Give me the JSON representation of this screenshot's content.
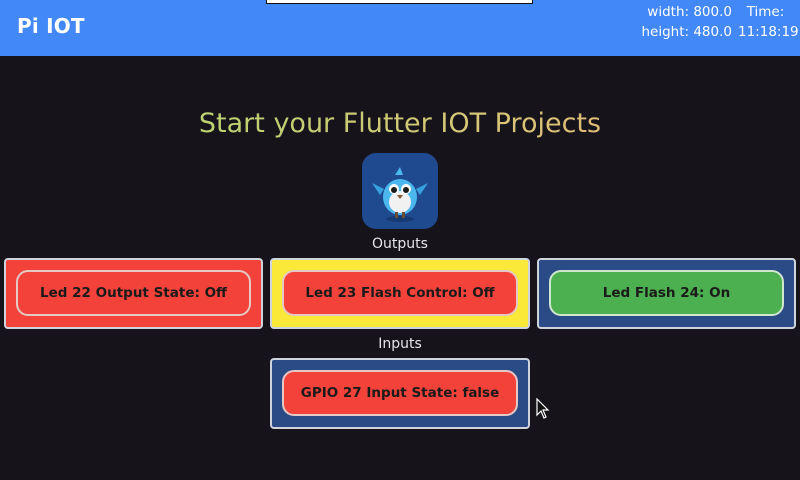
{
  "appbar": {
    "title": "Pi IOT",
    "width_text": "width: 800.0",
    "height_text": "height: 480.0",
    "time_label": "Time:",
    "time_value": "11:18:19",
    "color": "#4288f7"
  },
  "main": {
    "headline": "Start your Flutter IOT Projects",
    "logo_icon": "flutter-bird-mascot-icon",
    "outputs_label": "Outputs",
    "inputs_label": "Inputs"
  },
  "outputs": [
    {
      "label": "Led 22 Output State: Off",
      "state": "off",
      "color": "#f2423a"
    },
    {
      "label": "Led 23 Flash Control: Off",
      "state": "off",
      "color": "#f2423a"
    },
    {
      "label": "Led Flash 24: On",
      "state": "on",
      "color": "#4caf50"
    }
  ],
  "inputs": [
    {
      "label": "GPIO 27 Input State: false",
      "state": "false",
      "color": "#f2423a"
    }
  ]
}
